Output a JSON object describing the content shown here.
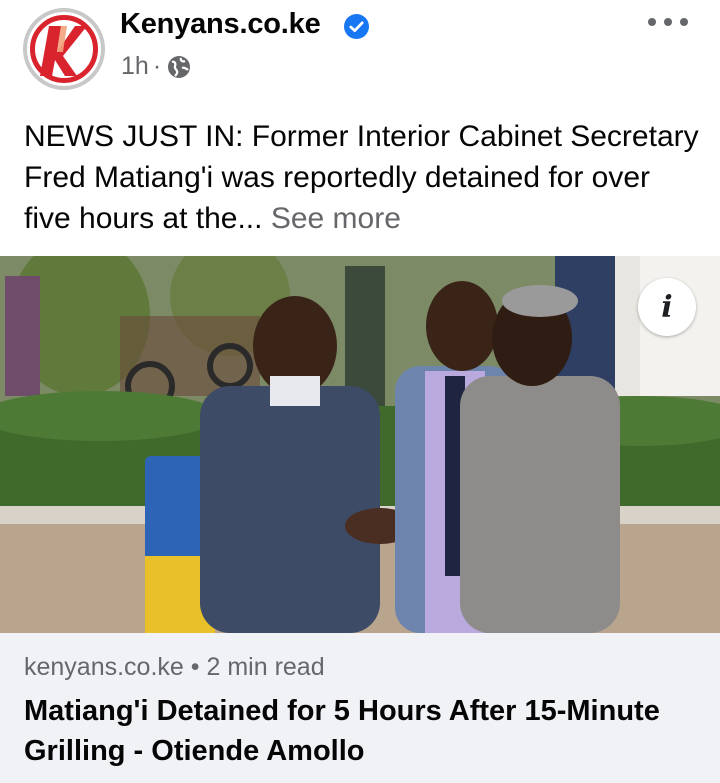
{
  "header": {
    "page_name": "Kenyans.co.ke",
    "timestamp": "1h",
    "separator": "·",
    "logo_letter": "K"
  },
  "post": {
    "text": "NEWS JUST IN: Former Interior Cabinet Secretary Fred Matiang'i was reportedly detained for over five hours at the...",
    "see_more": "See more"
  },
  "photo": {
    "info_button": "i"
  },
  "link": {
    "domain": "kenyans.co.ke",
    "dot": "•",
    "read_time": "2 min read",
    "title": "Matiang'i Detained for 5 Hours After 15-Minute Grilling - Otiende Amollo"
  },
  "colors": {
    "brand_red": "#d9232d",
    "verified_blue": "#1877f2",
    "secondary_text": "#65676b",
    "link_bg": "#f0f2f5"
  },
  "icons": [
    "kenyans-logo-icon",
    "verified-badge-icon",
    "globe-icon",
    "more-options-icon",
    "info-icon"
  ]
}
